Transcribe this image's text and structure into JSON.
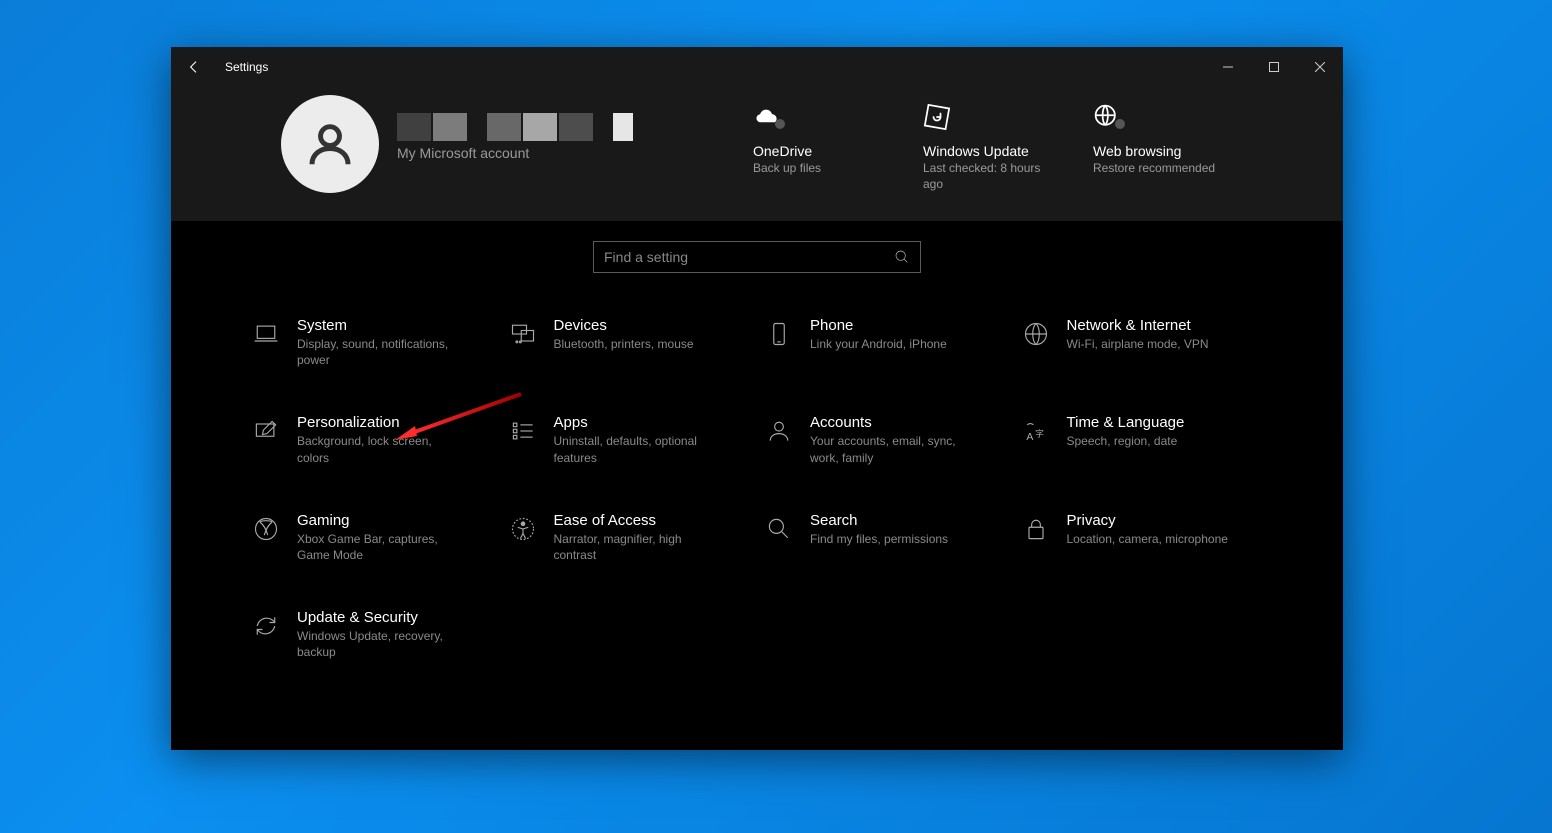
{
  "window": {
    "title": "Settings"
  },
  "account": {
    "label": "My Microsoft account"
  },
  "quick": [
    {
      "title": "OneDrive",
      "sub": "Back up files"
    },
    {
      "title": "Windows Update",
      "sub": "Last checked: 8 hours ago"
    },
    {
      "title": "Web browsing",
      "sub": "Restore recommended"
    }
  ],
  "search": {
    "placeholder": "Find a setting"
  },
  "categories": [
    {
      "title": "System",
      "sub": "Display, sound, notifications, power"
    },
    {
      "title": "Devices",
      "sub": "Bluetooth, printers, mouse"
    },
    {
      "title": "Phone",
      "sub": "Link your Android, iPhone"
    },
    {
      "title": "Network & Internet",
      "sub": "Wi-Fi, airplane mode, VPN"
    },
    {
      "title": "Personalization",
      "sub": "Background, lock screen, colors"
    },
    {
      "title": "Apps",
      "sub": "Uninstall, defaults, optional features"
    },
    {
      "title": "Accounts",
      "sub": "Your accounts, email, sync, work, family"
    },
    {
      "title": "Time & Language",
      "sub": "Speech, region, date"
    },
    {
      "title": "Gaming",
      "sub": "Xbox Game Bar, captures, Game Mode"
    },
    {
      "title": "Ease of Access",
      "sub": "Narrator, magnifier, high contrast"
    },
    {
      "title": "Search",
      "sub": "Find my files, permissions"
    },
    {
      "title": "Privacy",
      "sub": "Location, camera, microphone"
    },
    {
      "title": "Update & Security",
      "sub": "Windows Update, recovery, backup"
    }
  ]
}
